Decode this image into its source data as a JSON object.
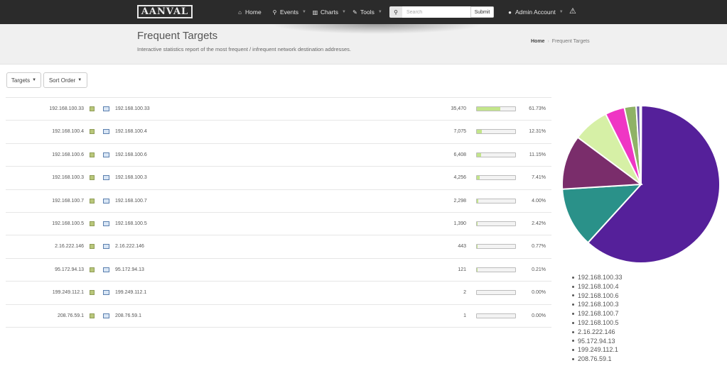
{
  "nav": {
    "logo": "AANVAL",
    "home": "Home",
    "events": "Events",
    "charts": "Charts",
    "tools": "Tools",
    "search_placeholder": "Search",
    "submit": "Submit",
    "admin": "Admin Account"
  },
  "header": {
    "title": "Frequent Targets",
    "subtitle": "Interactive statistics report of the most frequent / infrequent network destination addresses.",
    "breadcrumb_home": "Home",
    "breadcrumb_current": "Frequent Targets"
  },
  "toolbar": {
    "targets_label": "Targets",
    "sort_label": "Sort Order"
  },
  "rows": [
    {
      "ip": "192.168.100.33",
      "count": "35,470",
      "pct": "61.73%",
      "fraction": 0.6173
    },
    {
      "ip": "192.168.100.4",
      "count": "7,075",
      "pct": "12.31%",
      "fraction": 0.1231
    },
    {
      "ip": "192.168.100.6",
      "count": "6,408",
      "pct": "11.15%",
      "fraction": 0.1115
    },
    {
      "ip": "192.168.100.3",
      "count": "4,256",
      "pct": "7.41%",
      "fraction": 0.0741
    },
    {
      "ip": "192.168.100.7",
      "count": "2,298",
      "pct": "4.00%",
      "fraction": 0.04
    },
    {
      "ip": "192.168.100.5",
      "count": "1,390",
      "pct": "2.42%",
      "fraction": 0.0242
    },
    {
      "ip": "2.16.222.146",
      "count": "443",
      "pct": "0.77%",
      "fraction": 0.0077
    },
    {
      "ip": "95.172.94.13",
      "count": "121",
      "pct": "0.21%",
      "fraction": 0.0021
    },
    {
      "ip": "199.249.112.1",
      "count": "2",
      "pct": "0.00%",
      "fraction": 0.0
    },
    {
      "ip": "208.76.59.1",
      "count": "1",
      "pct": "0.00%",
      "fraction": 0.0
    }
  ],
  "chart_data": {
    "type": "pie",
    "categories": [
      "192.168.100.33",
      "192.168.100.4",
      "192.168.100.6",
      "192.168.100.3",
      "192.168.100.7",
      "192.168.100.5",
      "2.16.222.146",
      "95.172.94.13",
      "199.249.112.1",
      "208.76.59.1"
    ],
    "values": [
      35470,
      7075,
      6408,
      4256,
      2298,
      1390,
      443,
      121,
      2,
      1
    ],
    "colors": [
      "#55209a",
      "#2a9189",
      "#7a2d6b",
      "#d6f0a6",
      "#ef36c4",
      "#8fb266",
      "#6b58a8",
      "#5d8fa0",
      "#444444",
      "#888888"
    ],
    "legend": "bottom"
  }
}
